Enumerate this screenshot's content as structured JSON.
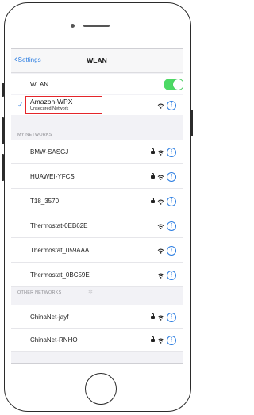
{
  "nav": {
    "back_label": "Settings",
    "title": "WLAN"
  },
  "wlan_row": {
    "label": "WLAN",
    "toggle_on": true
  },
  "connected": {
    "name": "Amazon-WPX",
    "subtitle": "Unsecured Network",
    "wifi": "wifi-icon",
    "info": "info-icon"
  },
  "sections": {
    "my_networks": "MY NETWORKS",
    "other_networks": "OTHER NETWORKS"
  },
  "my_networks": [
    {
      "name": "BMW-SASGJ",
      "locked": true
    },
    {
      "name": "HUAWEI-YFCS",
      "locked": true
    },
    {
      "name": "T18_3570",
      "locked": true
    },
    {
      "name": "Thermostat-0EB62E",
      "locked": false
    },
    {
      "name": "Thermostat_059AAA",
      "locked": false
    },
    {
      "name": "Thermostat_0BC59E",
      "locked": false
    }
  ],
  "other_networks": [
    {
      "name": "ChinaNet-jayf",
      "locked": true
    },
    {
      "name": "ChinaNet-RNHO",
      "locked": true
    }
  ],
  "colors": {
    "accent": "#2b7de1",
    "toggle": "#4cd964",
    "highlight": "#e4252a"
  },
  "info_glyph": "i"
}
